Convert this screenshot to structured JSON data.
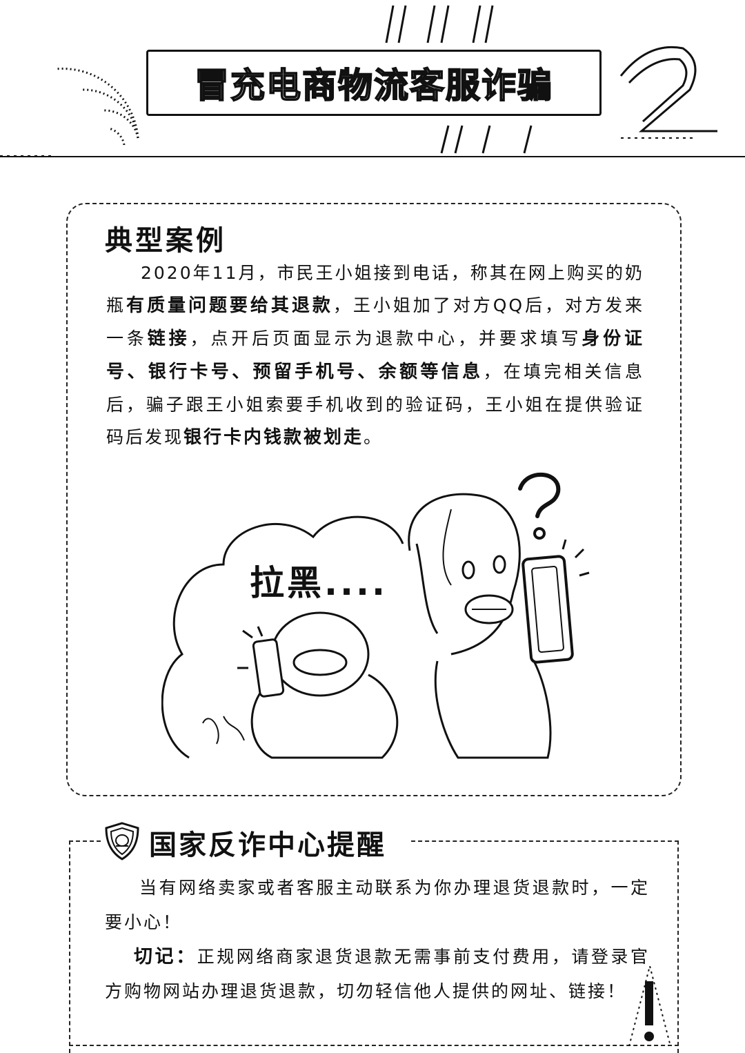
{
  "header": {
    "title": "冒充电商物流客服诈骗"
  },
  "case": {
    "heading": "典型案例",
    "segments": [
      {
        "text": "2020年11月，市民王小姐接到电话，称其在网上购买的奶瓶",
        "bold": false
      },
      {
        "text": "有质量问题要给其退款",
        "bold": true
      },
      {
        "text": "，王小姐加了对方QQ后，对方发来一条",
        "bold": false
      },
      {
        "text": "链接",
        "bold": true
      },
      {
        "text": "，点开后页面显示为退款中心，并要求填写",
        "bold": false
      },
      {
        "text": "身份证号、银行卡号、预留手机号、余额等信息",
        "bold": true
      },
      {
        "text": "，在填完相关信息后，骗子跟王小姐索要手机收到的验证码，王小姐在提供验证码后发现",
        "bold": false
      },
      {
        "text": "银行卡内钱款被划走",
        "bold": true
      },
      {
        "text": "。",
        "bold": false
      }
    ],
    "illustration": {
      "bubble_text": "拉黑....",
      "icons": [
        "question-mark-icon",
        "phone-icon"
      ]
    }
  },
  "tip": {
    "heading": "国家反诈中心提醒",
    "paragraph1": "当有网络卖家或者客服主动联系为你办理退货退款时，一定要小心！",
    "keyword": "切记：",
    "paragraph2": "正规网络商家退货退款无需事前支付费用，请登录官方购物网站办理退货退款，切勿轻信他人提供的网址、链接！",
    "icons": [
      "police-shield-icon",
      "exclamation-icon"
    ]
  }
}
